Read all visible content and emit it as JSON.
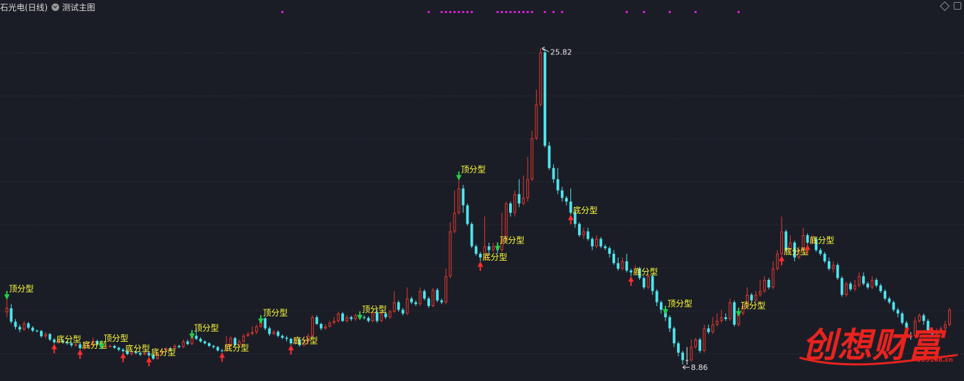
{
  "header": {
    "stock_title": "石光电(日线)",
    "indicator": "测试主图"
  },
  "colors": {
    "background": "#1b1d26",
    "up": "#e8392f",
    "down": "#4ee5ee",
    "doji": "#e6e6e6",
    "label_text": "#ffff3b",
    "top_arrow": "#22d04a",
    "bottom_arrow": "#ff2d2d",
    "signal_dots": "#e020e0",
    "gridline": "#3a3d4a"
  },
  "icons": [
    "chevron-down-icon",
    "diamond-icon",
    "window-button-icon"
  ],
  "chart_data": {
    "type": "candlestick",
    "title": "",
    "ylim": [
      8.2,
      27.6
    ],
    "annotations": {
      "max_label": "25.82",
      "max_value": 25.82,
      "min_label": "8.86",
      "min_value": 8.86
    },
    "candles": [
      [
        11.66,
        11.9,
        12.7,
        11.4
      ],
      [
        11.88,
        11.16,
        12.1,
        11.05
      ],
      [
        11.16,
        10.88,
        11.3,
        10.75
      ],
      [
        10.88,
        10.74,
        11.0,
        10.6
      ],
      [
        10.74,
        11.07,
        11.2,
        10.66
      ],
      [
        11.07,
        10.84,
        11.15,
        10.76
      ],
      [
        10.84,
        10.68,
        10.92,
        10.6
      ],
      [
        10.68,
        10.66,
        10.74,
        10.58
      ],
      [
        10.66,
        10.38,
        10.72,
        10.3
      ],
      [
        10.38,
        10.5,
        10.6,
        10.25
      ],
      [
        10.5,
        10.2,
        10.55,
        10.12
      ],
      [
        10.2,
        10.06,
        10.28,
        9.98
      ],
      [
        10.06,
        10.14,
        10.24,
        9.98
      ],
      [
        10.14,
        10.08,
        10.2,
        9.98
      ],
      [
        10.08,
        10.0,
        10.14,
        9.92
      ],
      [
        10.0,
        9.9,
        10.08,
        9.8
      ],
      [
        9.9,
        9.94,
        10.0,
        9.82
      ],
      [
        9.94,
        9.74,
        10.02,
        9.68
      ],
      [
        9.74,
        9.82,
        10.05,
        9.64
      ],
      [
        9.82,
        9.9,
        10.1,
        9.78
      ],
      [
        9.9,
        10.12,
        10.3,
        9.84
      ],
      [
        10.12,
        9.96,
        10.2,
        9.88
      ],
      [
        9.96,
        9.8,
        10.04,
        9.7
      ],
      [
        9.8,
        9.84,
        9.92,
        9.74
      ],
      [
        9.84,
        9.86,
        9.94,
        9.78
      ],
      [
        9.86,
        9.76,
        9.92,
        9.7
      ],
      [
        9.76,
        9.66,
        9.82,
        9.58
      ],
      [
        9.66,
        9.58,
        9.74,
        9.5
      ],
      [
        9.58,
        9.42,
        9.66,
        9.36
      ],
      [
        9.42,
        9.56,
        9.64,
        9.34
      ],
      [
        9.56,
        9.48,
        9.62,
        9.4
      ],
      [
        9.48,
        9.4,
        9.56,
        9.32
      ],
      [
        9.4,
        9.48,
        9.58,
        9.36
      ],
      [
        9.48,
        9.36,
        9.6,
        9.28
      ],
      [
        9.36,
        9.18,
        9.44,
        9.1
      ],
      [
        9.18,
        9.46,
        9.56,
        9.12
      ],
      [
        9.46,
        9.64,
        9.74,
        9.4
      ],
      [
        9.64,
        9.72,
        9.8,
        9.58
      ],
      [
        9.72,
        9.7,
        9.8,
        9.62
      ],
      [
        9.7,
        9.86,
        9.96,
        9.64
      ],
      [
        9.86,
        9.8,
        9.92,
        9.72
      ],
      [
        9.8,
        10.1,
        10.2,
        9.74
      ],
      [
        10.1,
        9.96,
        10.2,
        9.9
      ],
      [
        9.96,
        10.4,
        10.6,
        9.9
      ],
      [
        10.4,
        10.24,
        10.8,
        10.18
      ],
      [
        10.24,
        10.1,
        10.32,
        10.04
      ],
      [
        10.1,
        10.0,
        10.16,
        9.94
      ],
      [
        10.0,
        9.86,
        10.06,
        9.8
      ],
      [
        9.86,
        9.8,
        9.92,
        9.72
      ],
      [
        9.8,
        9.62,
        9.86,
        9.56
      ],
      [
        9.62,
        9.6,
        9.7,
        9.52
      ],
      [
        9.6,
        9.86,
        10.4,
        9.56
      ],
      [
        9.86,
        10.28,
        10.38,
        9.8
      ],
      [
        10.28,
        9.9,
        10.34,
        9.84
      ],
      [
        9.9,
        10.1,
        10.2,
        9.84
      ],
      [
        10.1,
        10.4,
        10.5,
        10.04
      ],
      [
        10.4,
        10.5,
        10.6,
        10.34
      ],
      [
        10.5,
        10.6,
        10.9,
        10.44
      ],
      [
        10.6,
        10.9,
        11.0,
        10.5
      ],
      [
        10.9,
        11.34,
        11.4,
        10.82
      ],
      [
        11.34,
        10.8,
        11.4,
        10.7
      ],
      [
        10.8,
        10.5,
        10.9,
        10.4
      ],
      [
        10.5,
        10.62,
        10.72,
        10.44
      ],
      [
        10.62,
        10.4,
        10.7,
        10.32
      ],
      [
        10.4,
        10.3,
        10.48,
        10.22
      ],
      [
        10.3,
        10.24,
        10.4,
        10.1
      ],
      [
        10.24,
        10.0,
        10.3,
        9.92
      ],
      [
        10.0,
        10.2,
        10.3,
        9.94
      ],
      [
        10.2,
        9.9,
        10.26,
        9.82
      ],
      [
        9.9,
        10.1,
        10.2,
        9.84
      ],
      [
        10.1,
        10.4,
        10.5,
        10.04
      ],
      [
        10.4,
        11.4,
        11.5,
        10.3
      ],
      [
        11.4,
        11.04,
        11.5,
        10.98
      ],
      [
        11.04,
        10.8,
        11.1,
        10.7
      ],
      [
        10.8,
        10.9,
        11.02,
        10.72
      ],
      [
        10.9,
        11.1,
        11.2,
        10.84
      ],
      [
        11.1,
        11.2,
        11.4,
        11.02
      ],
      [
        11.2,
        11.6,
        11.68,
        11.1
      ],
      [
        11.6,
        11.2,
        11.68,
        11.14
      ],
      [
        11.2,
        11.4,
        11.5,
        11.12
      ],
      [
        11.4,
        11.3,
        11.48,
        11.2
      ],
      [
        11.3,
        11.5,
        11.6,
        11.2
      ],
      [
        11.5,
        11.4,
        11.6,
        11.3
      ],
      [
        11.4,
        11.36,
        11.5,
        11.28
      ],
      [
        11.36,
        11.2,
        11.44,
        11.12
      ],
      [
        11.2,
        11.66,
        11.76,
        11.12
      ],
      [
        11.66,
        11.2,
        11.8,
        11.1
      ],
      [
        11.2,
        11.6,
        11.7,
        11.14
      ],
      [
        11.6,
        11.4,
        11.7,
        11.3
      ],
      [
        11.4,
        11.7,
        11.8,
        11.3
      ],
      [
        11.7,
        12.2,
        12.8,
        11.62
      ],
      [
        12.2,
        11.8,
        12.3,
        11.7
      ],
      [
        11.8,
        11.6,
        11.9,
        11.5
      ],
      [
        11.6,
        12.4,
        13.0,
        11.5
      ],
      [
        12.4,
        12.2,
        12.5,
        12.1
      ],
      [
        12.2,
        12.1,
        12.3,
        12.0
      ],
      [
        12.1,
        12.8,
        13.0,
        12.0
      ],
      [
        12.8,
        12.4,
        12.9,
        12.3
      ],
      [
        12.4,
        12.0,
        12.5,
        11.9
      ],
      [
        12.0,
        12.86,
        12.96,
        11.94
      ],
      [
        12.86,
        12.3,
        12.96,
        12.2
      ],
      [
        12.3,
        12.2,
        12.4,
        12.1
      ],
      [
        12.2,
        13.6,
        14.0,
        12.1
      ],
      [
        13.6,
        16.0,
        16.5,
        13.5
      ],
      [
        16.0,
        17.0,
        18.2,
        15.9
      ],
      [
        17.0,
        18.3,
        19.1,
        16.9
      ],
      [
        18.3,
        17.4,
        18.5,
        17.0
      ],
      [
        17.4,
        16.4,
        17.5,
        16.3
      ],
      [
        16.4,
        15.2,
        16.5,
        15.1
      ],
      [
        15.2,
        14.8,
        15.3,
        14.7
      ],
      [
        14.8,
        14.6,
        14.9,
        14.4
      ],
      [
        14.6,
        15.2,
        16.8,
        14.5
      ],
      [
        15.2,
        15.0,
        15.4,
        14.8
      ],
      [
        15.0,
        15.2,
        15.4,
        14.9
      ],
      [
        15.2,
        15.0,
        15.3,
        14.8
      ],
      [
        15.0,
        15.6,
        17.0,
        14.9
      ],
      [
        15.6,
        17.5,
        17.6,
        15.5
      ],
      [
        17.5,
        17.0,
        17.6,
        16.8
      ],
      [
        17.0,
        18.0,
        18.2,
        16.8
      ],
      [
        18.0,
        17.5,
        18.8,
        17.3
      ],
      [
        17.5,
        17.8,
        19.0,
        17.4
      ],
      [
        17.8,
        18.8,
        20.0,
        17.6
      ],
      [
        18.8,
        21.0,
        21.4,
        18.7
      ],
      [
        21.0,
        22.8,
        23.6,
        20.9
      ],
      [
        22.8,
        25.6,
        25.82,
        22.7
      ],
      [
        25.6,
        20.6,
        25.8,
        20.5
      ],
      [
        20.6,
        19.4,
        20.8,
        19.3
      ],
      [
        19.4,
        18.8,
        19.6,
        18.6
      ],
      [
        18.8,
        18.2,
        19.4,
        18.0
      ],
      [
        18.2,
        17.8,
        18.4,
        17.6
      ],
      [
        17.8,
        17.6,
        17.9,
        17.4
      ],
      [
        17.6,
        17.0,
        18.3,
        16.9
      ],
      [
        17.0,
        16.4,
        17.1,
        16.2
      ],
      [
        16.4,
        15.8,
        16.5,
        15.7
      ],
      [
        15.8,
        16.0,
        16.2,
        15.6
      ],
      [
        16.0,
        15.6,
        16.2,
        15.5
      ],
      [
        15.6,
        15.2,
        15.7,
        15.0
      ],
      [
        15.2,
        15.6,
        15.8,
        15.1
      ],
      [
        15.6,
        15.2,
        15.7,
        15.1
      ],
      [
        15.2,
        15.1,
        15.3,
        15.0
      ],
      [
        15.1,
        14.8,
        15.2,
        14.6
      ],
      [
        14.8,
        14.3,
        15.0,
        14.2
      ],
      [
        14.3,
        14.0,
        14.6,
        13.9
      ],
      [
        14.0,
        14.4,
        14.6,
        13.9
      ],
      [
        14.4,
        13.9,
        14.8,
        13.8
      ],
      [
        13.9,
        13.8,
        14.0,
        13.6
      ],
      [
        13.8,
        14.0,
        14.2,
        13.7
      ],
      [
        14.0,
        13.5,
        14.1,
        13.4
      ],
      [
        13.5,
        13.0,
        13.6,
        12.9
      ],
      [
        13.0,
        13.6,
        13.7,
        12.9
      ],
      [
        13.6,
        12.8,
        13.7,
        12.6
      ],
      [
        12.8,
        12.2,
        12.9,
        12.0
      ],
      [
        12.2,
        11.8,
        12.3,
        11.6
      ],
      [
        11.8,
        11.4,
        11.9,
        11.2
      ],
      [
        11.4,
        10.8,
        11.5,
        10.6
      ],
      [
        10.8,
        10.0,
        10.9,
        9.8
      ],
      [
        10.0,
        9.5,
        10.1,
        9.3
      ],
      [
        9.5,
        9.1,
        9.6,
        8.86
      ],
      [
        9.1,
        9.1,
        9.8,
        8.86
      ],
      [
        9.1,
        9.8,
        10.2,
        9.0
      ],
      [
        9.8,
        10.2,
        10.3,
        9.7
      ],
      [
        10.2,
        9.6,
        10.3,
        9.5
      ],
      [
        9.6,
        10.8,
        11.0,
        9.5
      ],
      [
        10.8,
        10.6,
        11.0,
        10.5
      ],
      [
        10.6,
        11.0,
        11.4,
        10.5
      ],
      [
        11.0,
        11.2,
        11.6,
        10.9
      ],
      [
        11.2,
        11.4,
        11.8,
        11.1
      ],
      [
        11.4,
        11.3,
        11.6,
        11.2
      ],
      [
        11.3,
        12.2,
        12.4,
        11.2
      ],
      [
        12.2,
        11.0,
        12.3,
        10.9
      ],
      [
        11.0,
        11.6,
        11.8,
        10.9
      ],
      [
        11.6,
        12.0,
        12.2,
        11.5
      ],
      [
        12.0,
        12.6,
        13.0,
        11.9
      ],
      [
        12.6,
        12.3,
        12.7,
        12.2
      ],
      [
        12.3,
        12.6,
        12.8,
        12.2
      ],
      [
        12.6,
        12.8,
        13.4,
        12.5
      ],
      [
        12.8,
        13.4,
        13.6,
        12.7
      ],
      [
        13.4,
        13.0,
        13.5,
        12.9
      ],
      [
        13.0,
        14.0,
        14.4,
        12.9
      ],
      [
        14.0,
        14.8,
        15.0,
        13.9
      ],
      [
        14.8,
        16.0,
        16.8,
        14.7
      ],
      [
        16.0,
        15.0,
        16.1,
        14.9
      ],
      [
        15.0,
        15.4,
        15.8,
        14.8
      ],
      [
        15.4,
        14.6,
        15.5,
        14.4
      ],
      [
        14.6,
        15.0,
        15.2,
        14.5
      ],
      [
        15.0,
        15.8,
        16.2,
        14.9
      ],
      [
        15.8,
        15.4,
        15.9,
        15.3
      ],
      [
        15.4,
        15.6,
        15.8,
        15.3
      ],
      [
        15.6,
        15.0,
        15.7,
        14.9
      ],
      [
        15.0,
        14.8,
        15.1,
        14.7
      ],
      [
        14.8,
        14.4,
        14.9,
        14.3
      ],
      [
        14.4,
        14.0,
        14.6,
        13.9
      ],
      [
        14.0,
        14.2,
        14.4,
        13.8
      ],
      [
        14.2,
        13.5,
        14.3,
        13.4
      ],
      [
        13.5,
        12.6,
        13.6,
        12.5
      ],
      [
        12.6,
        13.2,
        13.3,
        12.5
      ],
      [
        13.2,
        12.9,
        13.3,
        12.8
      ],
      [
        12.9,
        13.1,
        13.4,
        12.8
      ],
      [
        13.1,
        13.6,
        13.8,
        13.0
      ],
      [
        13.6,
        13.2,
        13.8,
        13.1
      ],
      [
        13.2,
        13.0,
        13.3,
        12.9
      ],
      [
        13.0,
        13.4,
        13.6,
        12.9
      ],
      [
        13.4,
        13.1,
        13.5,
        13.0
      ],
      [
        13.1,
        12.8,
        13.2,
        12.7
      ],
      [
        12.8,
        12.4,
        12.9,
        12.3
      ],
      [
        12.4,
        12.2,
        12.5,
        12.1
      ],
      [
        12.2,
        11.8,
        12.3,
        11.7
      ],
      [
        11.8,
        11.6,
        11.9,
        11.4
      ],
      [
        11.6,
        11.1,
        11.7,
        11.0
      ],
      [
        11.1,
        10.4,
        11.2,
        10.3
      ],
      [
        10.4,
        10.4,
        10.6,
        10.2
      ],
      [
        10.4,
        11.2,
        11.4,
        10.3
      ],
      [
        11.2,
        11.5,
        11.6,
        11.1
      ],
      [
        11.5,
        11.2,
        11.6,
        11.0
      ],
      [
        11.2,
        10.7,
        11.3,
        10.6
      ],
      [
        10.7,
        10.5,
        10.8,
        10.4
      ],
      [
        10.5,
        10.7,
        10.8,
        10.4
      ],
      [
        10.7,
        10.8,
        10.9,
        10.6
      ],
      [
        10.8,
        11.0,
        11.2,
        10.7
      ],
      [
        11.0,
        11.8,
        11.9,
        10.9
      ]
    ],
    "signals": [
      {
        "index": 0,
        "type": "top",
        "label": "顶分型"
      },
      {
        "index": 11,
        "type": "bottom",
        "label": "底分型"
      },
      {
        "index": 17,
        "type": "bottom",
        "label": "底分型"
      },
      {
        "index": 22,
        "type": "top",
        "label": "顶分型"
      },
      {
        "index": 27,
        "type": "bottom",
        "label": "底分型"
      },
      {
        "index": 33,
        "type": "bottom",
        "label": "底分型"
      },
      {
        "index": 43,
        "type": "top",
        "label": "顶分型"
      },
      {
        "index": 50,
        "type": "bottom",
        "label": "底分型"
      },
      {
        "index": 59,
        "type": "top",
        "label": "顶分型"
      },
      {
        "index": 66,
        "type": "bottom",
        "label": "底分型"
      },
      {
        "index": 82,
        "type": "top",
        "label": "顶分型"
      },
      {
        "index": 105,
        "type": "top",
        "label": "顶分型"
      },
      {
        "index": 110,
        "type": "bottom",
        "label": "底分型"
      },
      {
        "index": 114,
        "type": "top",
        "label": "顶分型"
      },
      {
        "index": 131,
        "type": "bottom",
        "label": "底分型"
      },
      {
        "index": 145,
        "type": "bottom",
        "label": "底分型"
      },
      {
        "index": 153,
        "type": "top",
        "label": "顶分型"
      },
      {
        "index": 170,
        "type": "top",
        "label": "顶分型"
      },
      {
        "index": 180,
        "type": "bottom",
        "label": "底分型"
      },
      {
        "index": 186,
        "type": "bottom",
        "label": "底分型"
      }
    ],
    "signal_dots_index": [
      64,
      98,
      101,
      102,
      103,
      104,
      105,
      106,
      107,
      108,
      114,
      115,
      116,
      117,
      118,
      119,
      120,
      121,
      122,
      125,
      127,
      129,
      144,
      148,
      154,
      160,
      170
    ]
  },
  "watermark": {
    "text": "创想财富",
    "url": "995168.cn"
  }
}
